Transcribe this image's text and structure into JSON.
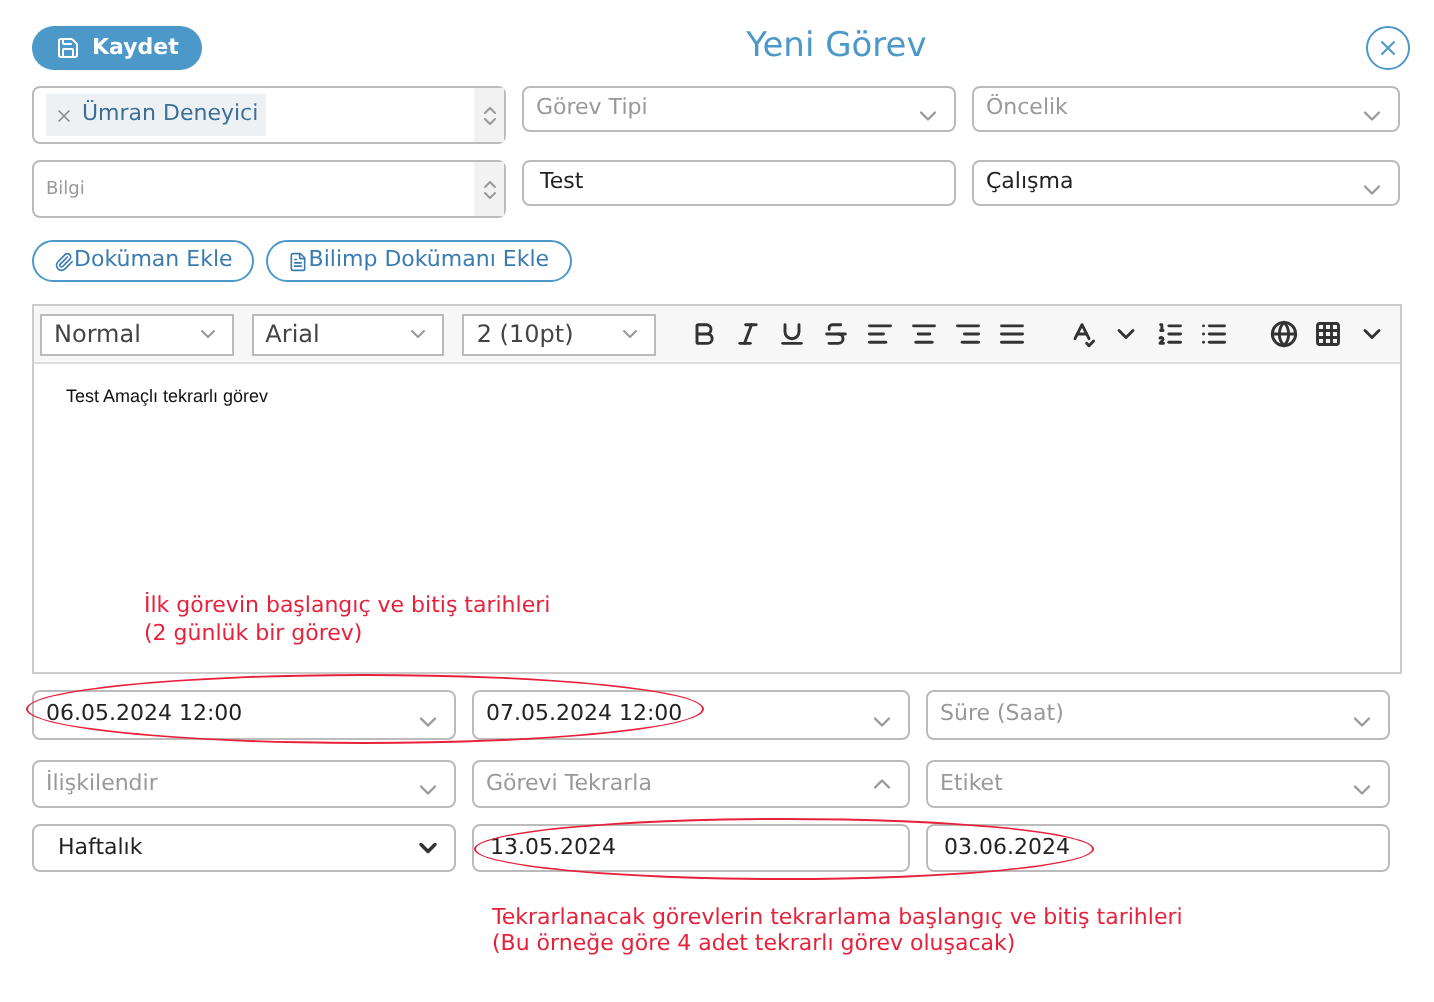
{
  "header": {
    "save_button": "Kaydet",
    "title": "Yeni Görev"
  },
  "top_rows": [
    [
      {
        "kind": "tags",
        "tags": [
          "Ümran Deneyici"
        ]
      },
      {
        "kind": "select",
        "placeholder": "Görev Tipi"
      },
      {
        "kind": "select",
        "placeholder": "Öncelik"
      }
    ],
    [
      {
        "kind": "textarea",
        "placeholder": "Bilgi"
      },
      {
        "kind": "text",
        "value": "Test"
      },
      {
        "kind": "select",
        "value": "Çalışma"
      }
    ]
  ],
  "attach_buttons": [
    {
      "kind": "paperclip",
      "label": "Doküman Ekle"
    },
    {
      "kind": "file",
      "label": "Bilimp Dokümanı Ekle"
    }
  ],
  "editor": {
    "style": "Normal",
    "font": "Arial",
    "size": "2 (10pt)",
    "content": "Test Amaçlı tekrarlı görev"
  },
  "annotation_1": [
    "İlk görevin başlangıç ve bitiş tarihleri",
    "(2 günlük bir görev)"
  ],
  "bottom_rows": [
    [
      {
        "kind": "select",
        "value": "06.05.2024 12:00"
      },
      {
        "kind": "select",
        "value": "07.05.2024 12:00"
      },
      {
        "kind": "select",
        "placeholder": "Süre (Saat)"
      }
    ],
    [
      {
        "kind": "select",
        "placeholder": "İlişkilendir"
      },
      {
        "kind": "toggle",
        "placeholder": "Görevi Tekrarla",
        "expanded": true
      },
      {
        "kind": "select",
        "placeholder": "Etiket"
      }
    ],
    [
      {
        "kind": "dropdown",
        "value": "Haftalık"
      },
      {
        "kind": "text",
        "value": "13.05.2024"
      },
      {
        "kind": "text",
        "value": "03.06.2024"
      }
    ]
  ],
  "annotation_2": [
    "Tekrarlanacak görevlerin tekrarlama başlangıç ve bitiş tarihleri",
    "(Bu örneğe göre 4 adet tekrarlı görev oluşacak)"
  ]
}
